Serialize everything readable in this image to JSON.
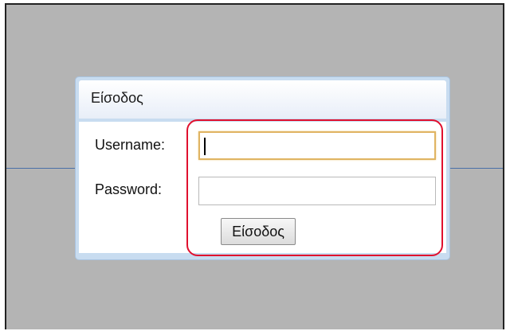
{
  "dialog": {
    "title": "Είσοδος",
    "username_label": "Username:",
    "username_value": "",
    "password_label": "Password:",
    "password_value": "",
    "submit_label": "Είσοδος"
  },
  "colors": {
    "backdrop": "#b4b4b4",
    "dialog_frame": "#c8dcf0",
    "focus_border": "#e0b462",
    "highlight": "#e0102e"
  }
}
